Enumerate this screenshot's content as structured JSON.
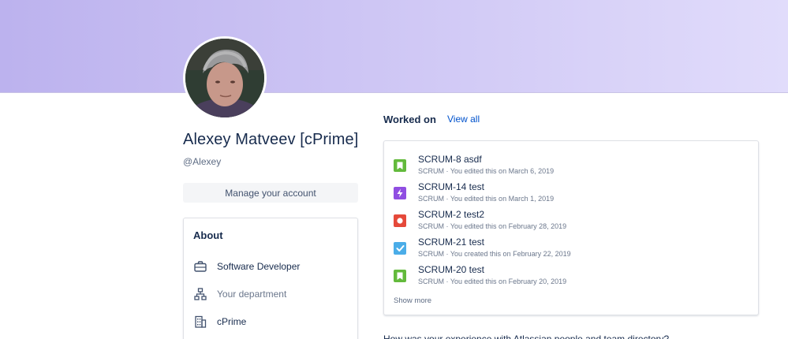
{
  "profile": {
    "name": "Alexey Matveev [cPrime]",
    "handle": "@Alexey",
    "manage_label": "Manage your account"
  },
  "about": {
    "title": "About",
    "rows": [
      {
        "icon": "briefcase-icon",
        "text": "Software Developer"
      },
      {
        "icon": "org-chart-icon",
        "text": "Your department"
      },
      {
        "icon": "building-icon",
        "text": "cPrime"
      }
    ]
  },
  "worked_on": {
    "title": "Worked on",
    "view_all": "View all",
    "items": [
      {
        "type": "story",
        "color": "#63ba3c",
        "title": "SCRUM-8 asdf",
        "project": "SCRUM",
        "detail": "You edited this on March 6, 2019"
      },
      {
        "type": "epic",
        "color": "#904ee2",
        "title": "SCRUM-14 test",
        "project": "SCRUM",
        "detail": "You edited this on March 1, 2019"
      },
      {
        "type": "bug",
        "color": "#e5493a",
        "title": "SCRUM-2 test2",
        "project": "SCRUM",
        "detail": "You edited this on February 28, 2019"
      },
      {
        "type": "task",
        "color": "#4bade8",
        "title": "SCRUM-21 test",
        "project": "SCRUM",
        "detail": "You created this on February 22, 2019"
      },
      {
        "type": "story",
        "color": "#63ba3c",
        "title": "SCRUM-20 test",
        "project": "SCRUM",
        "detail": "You edited this on February 20, 2019"
      }
    ],
    "show_more": "Show more",
    "separator": " · "
  },
  "footer_cut": "How was your experience with Atlassian people and team directory?"
}
